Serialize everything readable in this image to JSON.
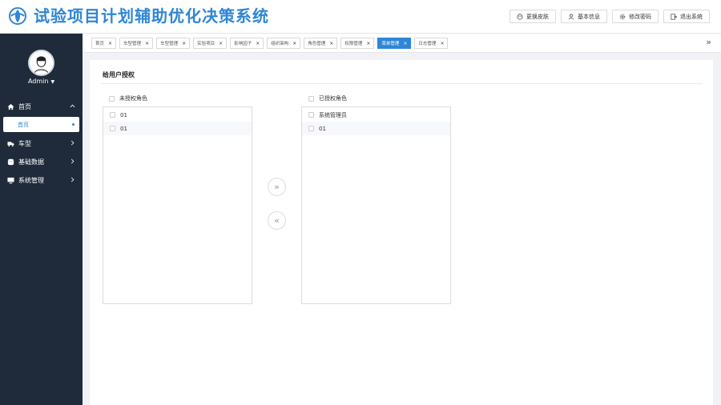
{
  "app": {
    "title": "试验项目计划辅助优化决策系统",
    "brand_color": "#2f86d6"
  },
  "header": {
    "buttons": [
      {
        "label": "更换皮肤",
        "icon": "palette-icon"
      },
      {
        "label": "基本信息",
        "icon": "user-icon"
      },
      {
        "label": "修改密码",
        "icon": "gear-icon"
      },
      {
        "label": "退出系统",
        "icon": "logout-icon"
      }
    ]
  },
  "sidebar": {
    "user": "Admin",
    "items": [
      {
        "label": "首页",
        "icon": "home-icon",
        "expanded": true
      },
      {
        "label": "首页",
        "sub": true,
        "selected": true
      },
      {
        "label": "车型",
        "icon": "truck-icon"
      },
      {
        "label": "基础数据",
        "icon": "database-icon"
      },
      {
        "label": "系统管理",
        "icon": "monitor-icon"
      }
    ]
  },
  "tabs": [
    {
      "label": "首页"
    },
    {
      "label": "车型管理"
    },
    {
      "label": "车型管理"
    },
    {
      "label": "实验项目"
    },
    {
      "label": "影响因子"
    },
    {
      "label": "组织架构"
    },
    {
      "label": "角色管理"
    },
    {
      "label": "权限管理"
    },
    {
      "label": "菜单管理",
      "active": true
    },
    {
      "label": "日志管理"
    }
  ],
  "main": {
    "title": "给用户授权",
    "left": {
      "header": "未授权角色",
      "items": [
        "01",
        "01"
      ]
    },
    "right": {
      "header": "已授权角色",
      "items": [
        "系统管理员",
        "01"
      ]
    },
    "move_right_symbol": "»",
    "move_left_symbol": "«",
    "tabs_more_symbol": "»"
  }
}
